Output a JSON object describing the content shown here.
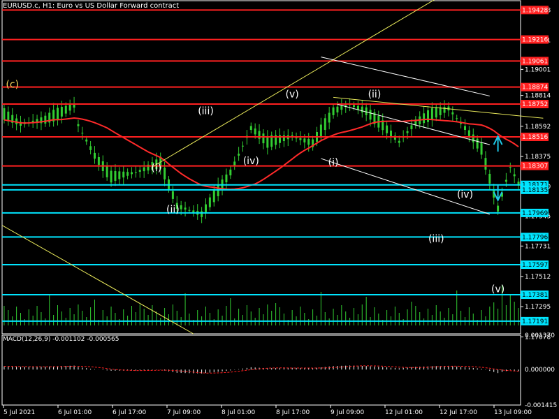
{
  "header": {
    "title": "EURUSD.c, H1:  Euro vs US Dollar Forward contract",
    "macd_label": "MACD(12,26,9) -0.001102 -0.000565"
  },
  "colors": {
    "background": "#000000",
    "axis": "#ffffff",
    "bull_candle": "#32cd32",
    "ma": "#ff2a2a",
    "red_level": "#ff2020",
    "cyan_level": "#00e5ff",
    "trend_yellow": "#e8e85a",
    "channel_white": "#ffffff",
    "volume": "#32cd32",
    "macd_hist": "#ffffff",
    "macd_signal": "#ff2020",
    "arrow": "#1ec8e6",
    "wave_yellow": "#f2d35a",
    "wave_white": "#ffffff"
  },
  "chart_data": {
    "type": "candlestick",
    "symbol": "EURUSD.c",
    "timeframe": "H1",
    "y_ticks": [
      "1.19428",
      "1.19211",
      "1.19001",
      "1.18814",
      "1.18592",
      "1.18375",
      "1.18160",
      "1.17945",
      "1.17731",
      "1.17512",
      "1.17295",
      "1.17078"
    ],
    "y_range": [
      1.171,
      1.195
    ],
    "x_labels": [
      "5 Jul 2021",
      "6 Jul 01:00",
      "6 Jul 17:00",
      "7 Jul 09:00",
      "8 Jul 01:00",
      "8 Jul 17:00",
      "9 Jul 09:00",
      "12 Jul 01:00",
      "12 Jul 17:00",
      "13 Jul 09:00"
    ],
    "red_levels": [
      {
        "label": "1.19428",
        "value": 1.19428
      },
      {
        "label": "1.19216",
        "value": 1.19216
      },
      {
        "label": "1.19061",
        "value": 1.19061
      },
      {
        "label": "1.18874",
        "value": 1.18874
      },
      {
        "label": "1.18752",
        "value": 1.18752
      },
      {
        "label": "1.18516",
        "value": 1.18516
      },
      {
        "label": "1.18307",
        "value": 1.18307
      }
    ],
    "cyan_levels": [
      {
        "label": "1.18171",
        "value": 1.18171
      },
      {
        "label": "1.18135",
        "value": 1.18135
      },
      {
        "label": "1.17969",
        "value": 1.17969
      },
      {
        "label": "1.17796",
        "value": 1.17796
      },
      {
        "label": "1.17597",
        "value": 1.17597
      },
      {
        "label": "1.17381",
        "value": 1.17381
      },
      {
        "label": "1.17191",
        "value": 1.17191
      }
    ],
    "wave_labels": [
      {
        "text": "(c)",
        "x": 2,
        "y": 1.1887,
        "color": "yellow"
      },
      {
        "text": "(i)",
        "x": 37,
        "y": 1.1827,
        "color": "white"
      },
      {
        "text": "(ii)",
        "x": 41,
        "y": 1.1797,
        "color": "white"
      },
      {
        "text": "(iii)",
        "x": 49,
        "y": 1.1868,
        "color": "white"
      },
      {
        "text": "(iv)",
        "x": 60,
        "y": 1.1832,
        "color": "white"
      },
      {
        "text": "(v)",
        "x": 70,
        "y": 1.188,
        "color": "white"
      },
      {
        "text": "(i)",
        "x": 80,
        "y": 1.1831,
        "color": "white"
      },
      {
        "text": "(ii)",
        "x": 90,
        "y": 1.188,
        "color": "white"
      },
      {
        "text": "(iv)",
        "x": 112,
        "y": 1.1808,
        "color": "white"
      },
      {
        "text": "(iii)",
        "x": 105,
        "y": 1.1776,
        "color": "white"
      },
      {
        "text": "(v)",
        "x": 120,
        "y": 1.174,
        "color": "white"
      }
    ],
    "macd": {
      "y_ticks": [
        "0.001370",
        "0.000000",
        "-0.001415"
      ],
      "range": [
        -0.001415,
        0.00137
      ]
    },
    "volume_scale_max": 100
  }
}
